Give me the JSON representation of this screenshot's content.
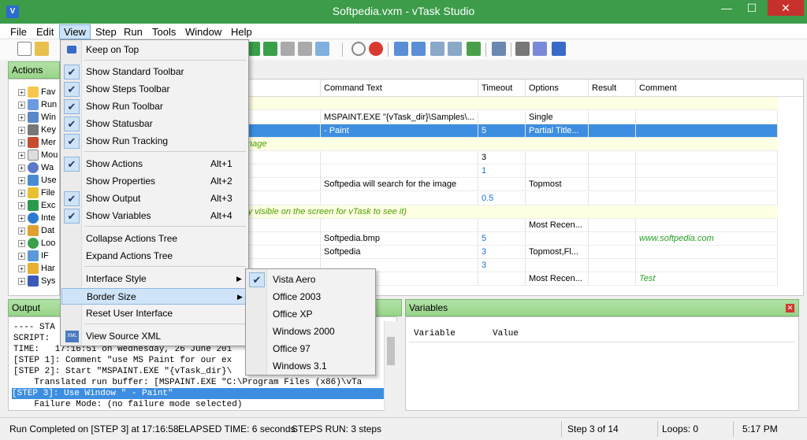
{
  "window": {
    "title": "Softpedia.vxm - vTask Studio",
    "min": "—",
    "max": "☐",
    "close": "✕"
  },
  "menubar": [
    "File",
    "Edit",
    "View",
    "Step",
    "Run",
    "Tools",
    "Window",
    "Help"
  ],
  "actions_panel": {
    "title": "Actions",
    "items": [
      "Fav",
      "Run",
      "Win",
      "Key",
      "Mer",
      "Mou",
      "Wa",
      "Use",
      "File",
      "Exc",
      "Inte",
      "Dat",
      "Loo",
      "IF",
      "Har",
      "Sys"
    ]
  },
  "grid": {
    "columns": [
      "n",
      "Command Text",
      "Timeout",
      "Options",
      "Result",
      "Comment"
    ],
    "rows": [
      {
        "c0": "nt for our example",
        "c1": "",
        "c2": "",
        "c3": "",
        "c5": "",
        "type": "comment"
      },
      {
        "c0": "",
        "c1": "MSPAINT.EXE \"{vTask_dir}\\Samples\\...",
        "c2": "",
        "c3": "Single",
        "c5": "",
        "type": "normal"
      },
      {
        "c0": "Window",
        "c1": " - Paint",
        "c2": "5",
        "c3": "Partial Title...",
        "c5": "",
        "type": "selected"
      },
      {
        "c0": "Paint window is big enough to show the whole image",
        "c1": "",
        "c2": "",
        "c3": "",
        "c5": "",
        "type": "comment"
      },
      {
        "c0": "e",
        "c1": "",
        "c2": "3",
        "c3": "",
        "c5": "",
        "type": "normal"
      },
      {
        "c0": "",
        "c1": "",
        "c2": "1",
        "c3": "",
        "c5": "",
        "type": "normal"
      },
      {
        "c0": "ay Message",
        "c1": "Softpedia will search for the image",
        "c2": "",
        "c3": "Topmost",
        "c5": "",
        "type": "normal"
      },
      {
        "c0": "",
        "c1": "",
        "c2": "0.5",
        "c3": "",
        "c5": "",
        "type": "normal"
      },
      {
        "c0": "aint window on top (the image must be physically visible on the screen for vTask to see it)",
        "c1": "",
        "c2": "",
        "c3": "",
        "c5": "",
        "type": "comment"
      },
      {
        "c0": "Window Style",
        "c1": "",
        "c2": "",
        "c3": "Most Recen...",
        "c5": "",
        "type": "normal"
      },
      {
        "c0": "to Image",
        "c1": "Softpedia.bmp",
        "c2": "5",
        "c3": "",
        "c5": "www.softpedia.com",
        "type": "normal"
      },
      {
        "c0": "on Popup",
        "c1": "Softpedia",
        "c2": "3",
        "c3": "Topmost,Fl...",
        "c5": "",
        "type": "normal"
      },
      {
        "c0": "",
        "c1": "",
        "c2": "3",
        "c3": "",
        "c5": "",
        "type": "normal"
      },
      {
        "c0": "",
        "c1": "",
        "c2": "",
        "c3": "Most Recen...",
        "c5": "Test",
        "type": "normal"
      }
    ]
  },
  "output_panel": {
    "title": "Output",
    "lines": [
      "---- STA",
      "SCRIPT:",
      "TIME:   17:16:51 on Wednesday, 26 June 201",
      "[STEP 1]: Comment \"use MS Paint for our ex",
      "[STEP 2]: Start \"MSPAINT.EXE \"{vTask_dir}\\",
      "    Translated run buffer: [MSPAINT.EXE \"C:\\Program Files (x86)\\vTa",
      "[STEP 3]: Use Window \" - Paint\"",
      "    Failure Mode: (no failure mode selected)"
    ]
  },
  "variables_panel": {
    "title": "Variables",
    "col1": "Variable",
    "col2": "Value"
  },
  "view_menu": {
    "items": [
      {
        "label": "Keep on Top",
        "shortcut": "",
        "checked": false
      },
      {
        "label": "Show Standard Toolbar",
        "shortcut": "",
        "checked": true
      },
      {
        "label": "Show Steps Toolbar",
        "shortcut": "",
        "checked": true
      },
      {
        "label": "Show Run Toolbar",
        "shortcut": "",
        "checked": true
      },
      {
        "label": "Show Statusbar",
        "shortcut": "",
        "checked": true
      },
      {
        "label": "Show Run Tracking",
        "shortcut": "",
        "checked": true
      },
      {
        "label": "Show Actions",
        "shortcut": "Alt+1",
        "checked": true
      },
      {
        "label": "Show Properties",
        "shortcut": "Alt+2",
        "checked": false
      },
      {
        "label": "Show Output",
        "shortcut": "Alt+3",
        "checked": true
      },
      {
        "label": "Show Variables",
        "shortcut": "Alt+4",
        "checked": true
      },
      {
        "label": "Collapse Actions Tree",
        "shortcut": "",
        "checked": false
      },
      {
        "label": "Expand Actions Tree",
        "shortcut": "",
        "checked": false
      },
      {
        "label": "Interface Style",
        "shortcut": "",
        "checked": false
      },
      {
        "label": "Border Size",
        "shortcut": "",
        "checked": false
      },
      {
        "label": "Reset User Interface",
        "shortcut": "",
        "checked": false
      },
      {
        "label": "View Source XML",
        "shortcut": "",
        "checked": false
      }
    ]
  },
  "style_submenu": {
    "items": [
      "Vista Aero",
      "Office 2003",
      "Office XP",
      "Windows 2000",
      "Office 97",
      "Windows 3.1"
    ],
    "selected": "Vista Aero"
  },
  "statusbar": {
    "message": "Run Completed on [STEP 3] at 17:16:58",
    "elapsed": "ELAPSED TIME: 6 seconds",
    "steps": "STEPS RUN: 3 steps",
    "step": "Step 3 of 14",
    "loops": "Loops: 0",
    "time": "5:17 PM"
  },
  "colors": {
    "titlebar": "#3c9c4a",
    "panel_header": "#a6dc98",
    "selection": "#3d8ee0",
    "comment_text": "#4aa000"
  },
  "check_glyph": "✔",
  "submenu_arrow": "▶"
}
